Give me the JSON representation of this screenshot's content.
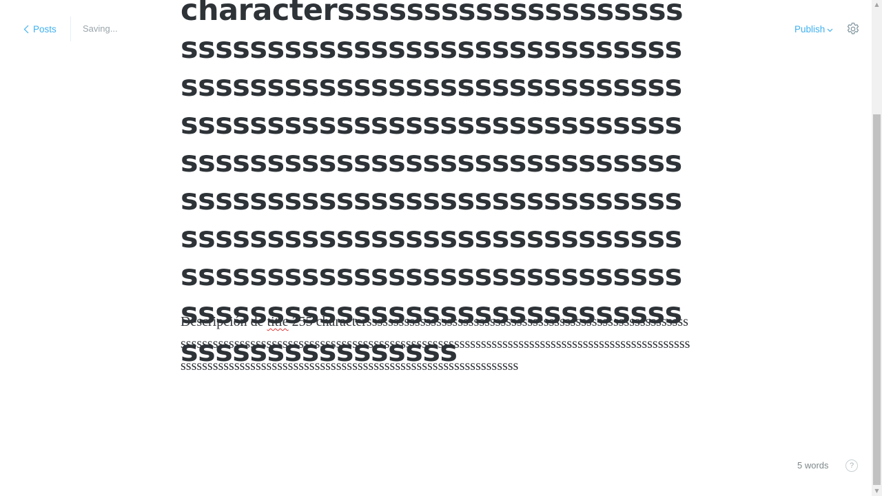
{
  "header": {
    "back_label": "Posts",
    "status": "Saving...",
    "publish_label": "Publish"
  },
  "editor": {
    "title": "characterssssssssssssssssssssssssssssssssssssssssssssssssssssssssssssssssssssssssssssssssssssssssssssssssssssssssssssssssssssssssssssssssssssssssssssssssssssssssssssssssssssssssssssssssssssssssssssssssssssssssssssssssssssssssssssssssssssssssssssssssssssssssssssssssssssssssssss",
    "body_prefix": "Descripción de ",
    "body_misspelled": "title",
    "body_suffix": " 255 characterssssssssssssssssssssssssssssssssssssssssssssssssssssssssssssssssssssssssssssssssssssssssssssssssssssssssssssssssssssssssssssssssssssssssssssssssssssssssssssssssssssssssssssssssssssssssssssssssssssssssssssssssssssssssss"
  },
  "footer": {
    "word_count": "5 words",
    "help_label": "?"
  },
  "colors": {
    "accent": "#3eb0ef",
    "text": "#2e3338",
    "muted": "#9aa5ab"
  },
  "icons": {
    "back": "chevron-left-icon",
    "publish": "chevron-down-icon",
    "settings": "gear-icon",
    "help": "help-circle-icon"
  }
}
